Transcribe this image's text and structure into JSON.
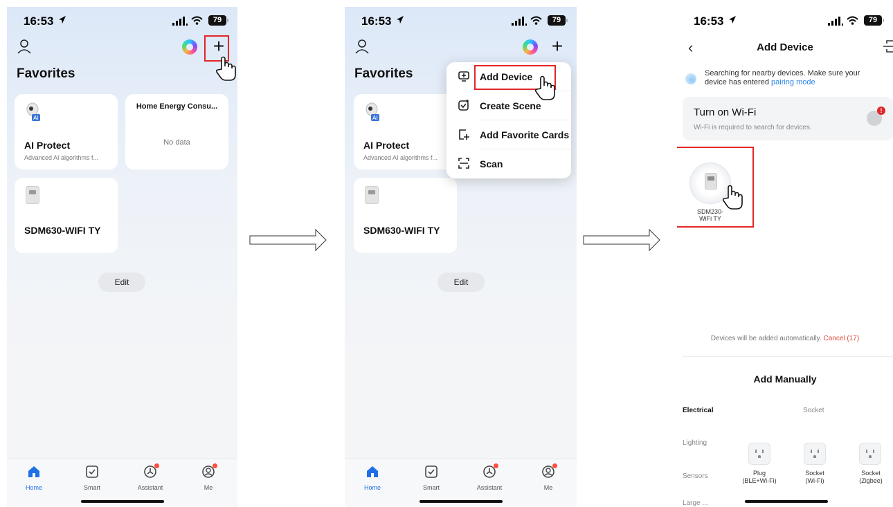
{
  "status": {
    "time": "16:53",
    "battery": "79"
  },
  "home": {
    "favorites_title": "Favorites",
    "cards": [
      {
        "title": "AI Protect",
        "subtitle": "Advanced AI algorithms f..."
      },
      {
        "title": "Home Energy Consu...",
        "value": "No data"
      },
      {
        "title": "SDM630-WIFI TY"
      }
    ],
    "edit_label": "Edit",
    "tabs": [
      "Home",
      "Smart",
      "Assistant",
      "Me"
    ]
  },
  "menu": {
    "items": [
      "Add Device",
      "Create Scene",
      "Add Favorite Cards",
      "Scan"
    ]
  },
  "add_device": {
    "title": "Add Device",
    "search_text": "Searching for nearby devices. Make sure your device has entered ",
    "pairing_link": "pairing mode",
    "wifi_title": "Turn on Wi-Fi",
    "wifi_sub": "Wi-Fi is required to search for devices.",
    "found_device_line1": "SDM230-",
    "found_device_line2": "WiFi TY",
    "auto_text": "Devices will be added automatically. ",
    "cancel_text": "Cancel (17)",
    "manual_title": "Add Manually",
    "categories": [
      "Electrical",
      "Lighting",
      "Sensors",
      "Large ..."
    ],
    "socket_header": "Socket",
    "products": [
      {
        "line1": "Plug",
        "line2": "(BLE+Wi-Fi)"
      },
      {
        "line1": "Socket",
        "line2": "(Wi-Fi)"
      },
      {
        "line1": "Socket",
        "line2": "(Zigbee)"
      }
    ]
  },
  "colors": {
    "accent": "#1f6fe6",
    "highlight": "#e12626",
    "alert": "#ff4d3d"
  }
}
